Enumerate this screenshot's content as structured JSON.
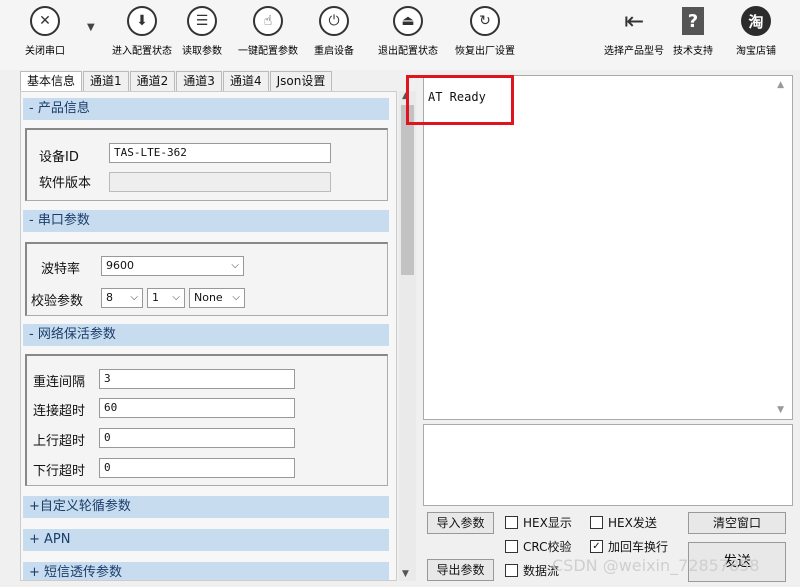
{
  "toolbar": {
    "close_port": "关闭串口",
    "enter_config": "进入配置状态",
    "read_params": "读取参数",
    "one_key_config": "一键配置参数",
    "restart": "重启设备",
    "exit_config": "退出配置状态",
    "factory_reset": "恢复出厂设置",
    "select_model": "选择产品型号",
    "tech_support": "技术支持",
    "taobao": "淘宝店铺",
    "taobao_glyph": "淘"
  },
  "tabs": [
    "基本信息",
    "通道1",
    "通道2",
    "通道3",
    "通道4",
    "Json设置"
  ],
  "product_info": {
    "header": "- 产品信息",
    "device_id_label": "设备ID",
    "device_id_value": "TAS-LTE-362",
    "fw_version_label": "软件版本",
    "fw_version_value": ""
  },
  "serial_params": {
    "header": "- 串口参数",
    "baud_label": "波特率",
    "baud_value": "9600",
    "check_label": "校验参数",
    "data_bits": "8",
    "stop_bits": "1",
    "parity": "None"
  },
  "keepalive": {
    "header": "- 网络保活参数",
    "reconnect_label": "重连间隔",
    "reconnect_value": "3",
    "conn_timeout_label": "连接超时",
    "conn_timeout_value": "60",
    "up_timeout_label": "上行超时",
    "up_timeout_value": "0",
    "down_timeout_label": "下行超时",
    "down_timeout_value": "0"
  },
  "collapsed": {
    "custom_poll": "+自定义轮循参数",
    "apn": "+ APN",
    "sms": "+ 短信透传参数"
  },
  "output": {
    "text": "AT Ready"
  },
  "bottom": {
    "import": "导入参数",
    "export": "导出参数",
    "hex_show": "HEX显示",
    "hex_send": "HEX发送",
    "crc": "CRC校验",
    "add_crlf": "加回车换行",
    "data_stream": "数据流",
    "clear": "清空窗口",
    "send": "发送",
    "watermark": "CSDN @weixin_72857858"
  }
}
